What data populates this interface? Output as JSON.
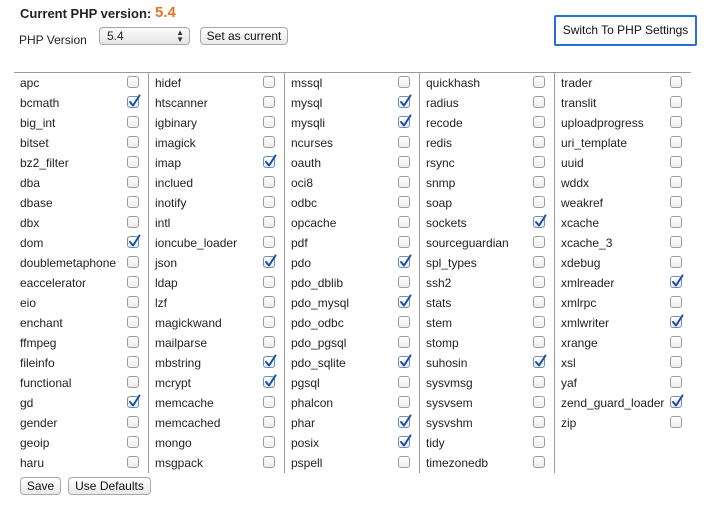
{
  "header": {
    "current_label": "Current PHP version:",
    "current_version": "5.4",
    "version_label": "PHP Version",
    "selected_version": "5.4",
    "set_current_label": "Set as current",
    "switch_label": "Switch To PHP Settings"
  },
  "colors": {
    "accent_version": "#e8742a",
    "checkmark": "#1a4fa8",
    "focus_border": "#2a6fd6"
  },
  "columns": [
    [
      {
        "name": "apc",
        "checked": false
      },
      {
        "name": "bcmath",
        "checked": true
      },
      {
        "name": "big_int",
        "checked": false
      },
      {
        "name": "bitset",
        "checked": false
      },
      {
        "name": "bz2_filter",
        "checked": false
      },
      {
        "name": "dba",
        "checked": false
      },
      {
        "name": "dbase",
        "checked": false
      },
      {
        "name": "dbx",
        "checked": false
      },
      {
        "name": "dom",
        "checked": true
      },
      {
        "name": "doublemetaphone",
        "checked": false
      },
      {
        "name": "eaccelerator",
        "checked": false
      },
      {
        "name": "eio",
        "checked": false
      },
      {
        "name": "enchant",
        "checked": false
      },
      {
        "name": "ffmpeg",
        "checked": false
      },
      {
        "name": "fileinfo",
        "checked": false
      },
      {
        "name": "functional",
        "checked": false
      },
      {
        "name": "gd",
        "checked": true
      },
      {
        "name": "gender",
        "checked": false
      },
      {
        "name": "geoip",
        "checked": false
      },
      {
        "name": "haru",
        "checked": false
      }
    ],
    [
      {
        "name": "hidef",
        "checked": false
      },
      {
        "name": "htscanner",
        "checked": false
      },
      {
        "name": "igbinary",
        "checked": false
      },
      {
        "name": "imagick",
        "checked": false
      },
      {
        "name": "imap",
        "checked": true
      },
      {
        "name": "inclued",
        "checked": false
      },
      {
        "name": "inotify",
        "checked": false
      },
      {
        "name": "intl",
        "checked": false
      },
      {
        "name": "ioncube_loader",
        "checked": false
      },
      {
        "name": "json",
        "checked": true
      },
      {
        "name": "ldap",
        "checked": false
      },
      {
        "name": "lzf",
        "checked": false
      },
      {
        "name": "magickwand",
        "checked": false
      },
      {
        "name": "mailparse",
        "checked": false
      },
      {
        "name": "mbstring",
        "checked": true
      },
      {
        "name": "mcrypt",
        "checked": true
      },
      {
        "name": "memcache",
        "checked": false
      },
      {
        "name": "memcached",
        "checked": false
      },
      {
        "name": "mongo",
        "checked": false
      },
      {
        "name": "msgpack",
        "checked": false
      }
    ],
    [
      {
        "name": "mssql",
        "checked": false
      },
      {
        "name": "mysql",
        "checked": true
      },
      {
        "name": "mysqli",
        "checked": true
      },
      {
        "name": "ncurses",
        "checked": false
      },
      {
        "name": "oauth",
        "checked": false
      },
      {
        "name": "oci8",
        "checked": false
      },
      {
        "name": "odbc",
        "checked": false
      },
      {
        "name": "opcache",
        "checked": false
      },
      {
        "name": "pdf",
        "checked": false
      },
      {
        "name": "pdo",
        "checked": true
      },
      {
        "name": "pdo_dblib",
        "checked": false
      },
      {
        "name": "pdo_mysql",
        "checked": true
      },
      {
        "name": "pdo_odbc",
        "checked": false
      },
      {
        "name": "pdo_pgsql",
        "checked": false
      },
      {
        "name": "pdo_sqlite",
        "checked": true
      },
      {
        "name": "pgsql",
        "checked": false
      },
      {
        "name": "phalcon",
        "checked": false
      },
      {
        "name": "phar",
        "checked": true
      },
      {
        "name": "posix",
        "checked": true
      },
      {
        "name": "pspell",
        "checked": false
      }
    ],
    [
      {
        "name": "quickhash",
        "checked": false
      },
      {
        "name": "radius",
        "checked": false
      },
      {
        "name": "recode",
        "checked": false
      },
      {
        "name": "redis",
        "checked": false
      },
      {
        "name": "rsync",
        "checked": false
      },
      {
        "name": "snmp",
        "checked": false
      },
      {
        "name": "soap",
        "checked": false
      },
      {
        "name": "sockets",
        "checked": true
      },
      {
        "name": "sourceguardian",
        "checked": false
      },
      {
        "name": "spl_types",
        "checked": false
      },
      {
        "name": "ssh2",
        "checked": false
      },
      {
        "name": "stats",
        "checked": false
      },
      {
        "name": "stem",
        "checked": false
      },
      {
        "name": "stomp",
        "checked": false
      },
      {
        "name": "suhosin",
        "checked": true
      },
      {
        "name": "sysvmsg",
        "checked": false
      },
      {
        "name": "sysvsem",
        "checked": false
      },
      {
        "name": "sysvshm",
        "checked": false
      },
      {
        "name": "tidy",
        "checked": false
      },
      {
        "name": "timezonedb",
        "checked": false
      }
    ],
    [
      {
        "name": "trader",
        "checked": false
      },
      {
        "name": "translit",
        "checked": false
      },
      {
        "name": "uploadprogress",
        "checked": false
      },
      {
        "name": "uri_template",
        "checked": false
      },
      {
        "name": "uuid",
        "checked": false
      },
      {
        "name": "wddx",
        "checked": false
      },
      {
        "name": "weakref",
        "checked": false
      },
      {
        "name": "xcache",
        "checked": false
      },
      {
        "name": "xcache_3",
        "checked": false
      },
      {
        "name": "xdebug",
        "checked": false
      },
      {
        "name": "xmlreader",
        "checked": true
      },
      {
        "name": "xmlrpc",
        "checked": false
      },
      {
        "name": "xmlwriter",
        "checked": true
      },
      {
        "name": "xrange",
        "checked": false
      },
      {
        "name": "xsl",
        "checked": false
      },
      {
        "name": "yaf",
        "checked": false
      },
      {
        "name": "zend_guard_loader",
        "checked": true
      },
      {
        "name": "zip",
        "checked": false
      }
    ]
  ],
  "footer": {
    "save_label": "Save",
    "defaults_label": "Use Defaults"
  }
}
